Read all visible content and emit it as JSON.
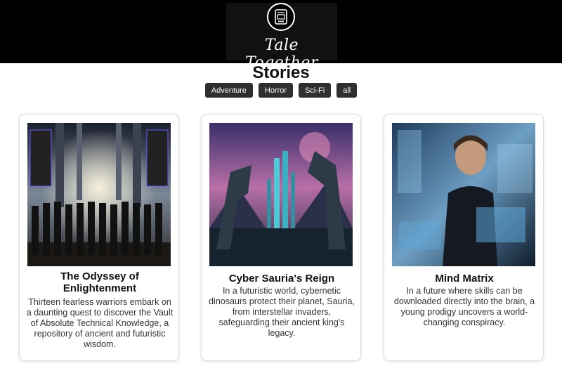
{
  "header": {
    "app_name": "Tale Together",
    "logo_icon": "book-logo-icon"
  },
  "page": {
    "title": "Stories"
  },
  "filters": [
    "Adventure",
    "Horror",
    "Sci-Fi",
    "all"
  ],
  "stories": [
    {
      "title": "The Odyssey of Enlightenment",
      "description": "Thirteen fearless warriors embark on a daunting quest to discover the Vault of Absolute Technical Knowledge, a repository of ancient and futuristic wisdom."
    },
    {
      "title": "Cyber Sauria's Reign",
      "description": "In a futuristic world, cybernetic dinosaurs protect their planet, Sauria, from interstellar invaders, safeguarding their ancient king's legacy."
    },
    {
      "title": "Mind Matrix",
      "description": "In a future where skills can be downloaded directly into the brain, a young prodigy uncovers a world-changing conspiracy."
    }
  ]
}
